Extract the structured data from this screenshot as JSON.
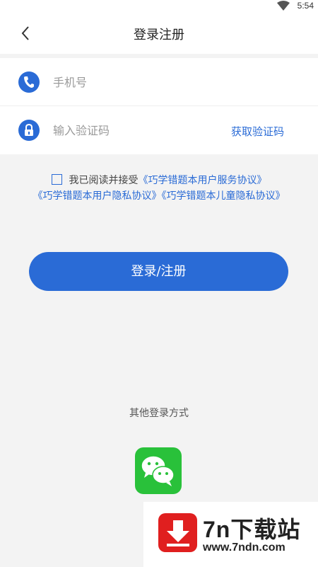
{
  "status_bar": {
    "time": "5:54",
    "wifi_icon": "wifi-icon"
  },
  "header": {
    "title": "登录注册",
    "back_icon": "back-arrow-icon"
  },
  "form": {
    "phone": {
      "placeholder": "手机号",
      "value": "",
      "icon": "phone-icon"
    },
    "code": {
      "placeholder": "输入验证码",
      "value": "",
      "icon": "lock-icon",
      "get_code_label": "获取验证码"
    }
  },
  "agreement": {
    "checked": false,
    "prefix": "我已阅读并接受",
    "service": "《巧学错题本用户服务协议》",
    "privacy": "《巧学错题本用户隐私协议》",
    "children": "《巧学错题本儿童隐私协议》"
  },
  "login_button": "登录/注册",
  "other_login": {
    "label": "其他登录方式",
    "wechat_icon": "wechat-icon"
  },
  "watermark": {
    "name": "7n下载站",
    "url": "www.7ndn.com",
    "icon": "download-arrow-icon"
  },
  "colors": {
    "accent": "#2a6bd6",
    "wechat": "#29c13a",
    "watermark_red": "#e01f1f",
    "background": "#f3f3f3"
  }
}
